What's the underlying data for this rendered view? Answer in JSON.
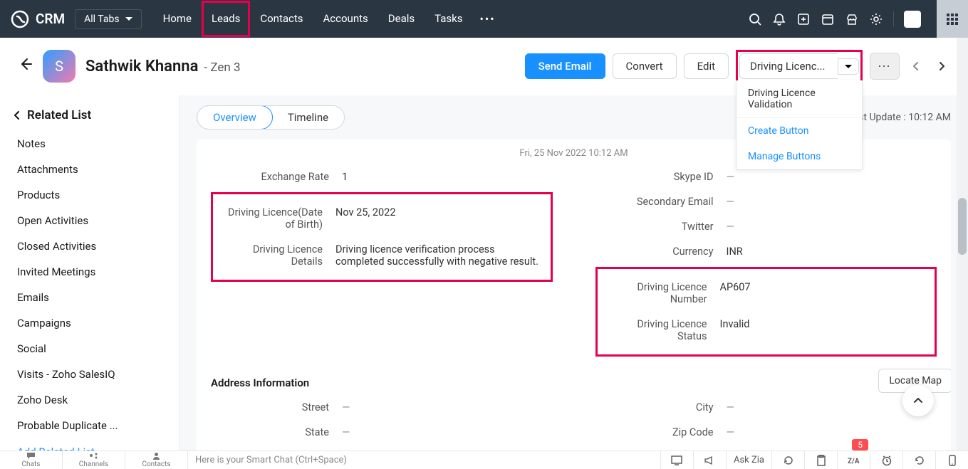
{
  "app": {
    "name": "CRM",
    "all_tabs": "All Tabs"
  },
  "nav": {
    "tabs": [
      "Home",
      "Leads",
      "Contacts",
      "Accounts",
      "Deals",
      "Tasks"
    ]
  },
  "record": {
    "avatar_initial": "S",
    "name": "Sathwik Khanna",
    "company_prefix": "-",
    "company": "Zen 3"
  },
  "actions": {
    "send_email": "Send Email",
    "convert": "Convert",
    "edit": "Edit",
    "custom_button": "Driving Licenc...",
    "more": "⋯"
  },
  "dropdown": {
    "item1": "Driving Licence Validation",
    "item2": "Create Button",
    "item3": "Manage Buttons"
  },
  "sidebar": {
    "title": "Related List",
    "items": [
      "Notes",
      "Attachments",
      "Products",
      "Open Activities",
      "Closed Activities",
      "Invited Meetings",
      "Emails",
      "Campaigns",
      "Social",
      "Visits - Zoho SalesIQ",
      "Zoho Desk",
      "Probable Duplicate ..."
    ],
    "add": "Add Related List"
  },
  "view_tabs": {
    "overview": "Overview",
    "timeline": "Timeline"
  },
  "last_update_label": "Last Update :",
  "last_update_time": "10:12 AM",
  "timestamp_top": "Fri, 25 Nov 2022 10:12 AM",
  "fields_left": {
    "exchange_rate": {
      "label": "Exchange Rate",
      "value": "1"
    },
    "dl_dob": {
      "label": "Driving Licence(Date of Birth)",
      "value": "Nov 25, 2022"
    },
    "dl_details": {
      "label": "Driving Licence Details",
      "value": "Driving licence verification process completed successfully with negative result."
    }
  },
  "fields_right": {
    "skype": {
      "label": "Skype ID",
      "value": "—"
    },
    "secondary_email": {
      "label": "Secondary Email",
      "value": "—"
    },
    "twitter": {
      "label": "Twitter",
      "value": "—"
    },
    "currency": {
      "label": "Currency",
      "value": "INR"
    },
    "dl_number": {
      "label": "Driving Licence Number",
      "value": "AP607"
    },
    "dl_status": {
      "label": "Driving Licence Status",
      "value": "Invalid"
    }
  },
  "address_section": {
    "title": "Address Information",
    "locate_map": "Locate Map",
    "street": {
      "label": "Street",
      "value": "—"
    },
    "state": {
      "label": "State",
      "value": "—"
    },
    "city": {
      "label": "City",
      "value": "—"
    },
    "zip": {
      "label": "Zip Code",
      "value": "—"
    }
  },
  "bottom": {
    "tabs": [
      "Chats",
      "Channels",
      "Contacts"
    ],
    "smart_chat": "Here is your Smart Chat (Ctrl+Space)",
    "ask_zia": "Ask Zia",
    "badge": "5"
  }
}
